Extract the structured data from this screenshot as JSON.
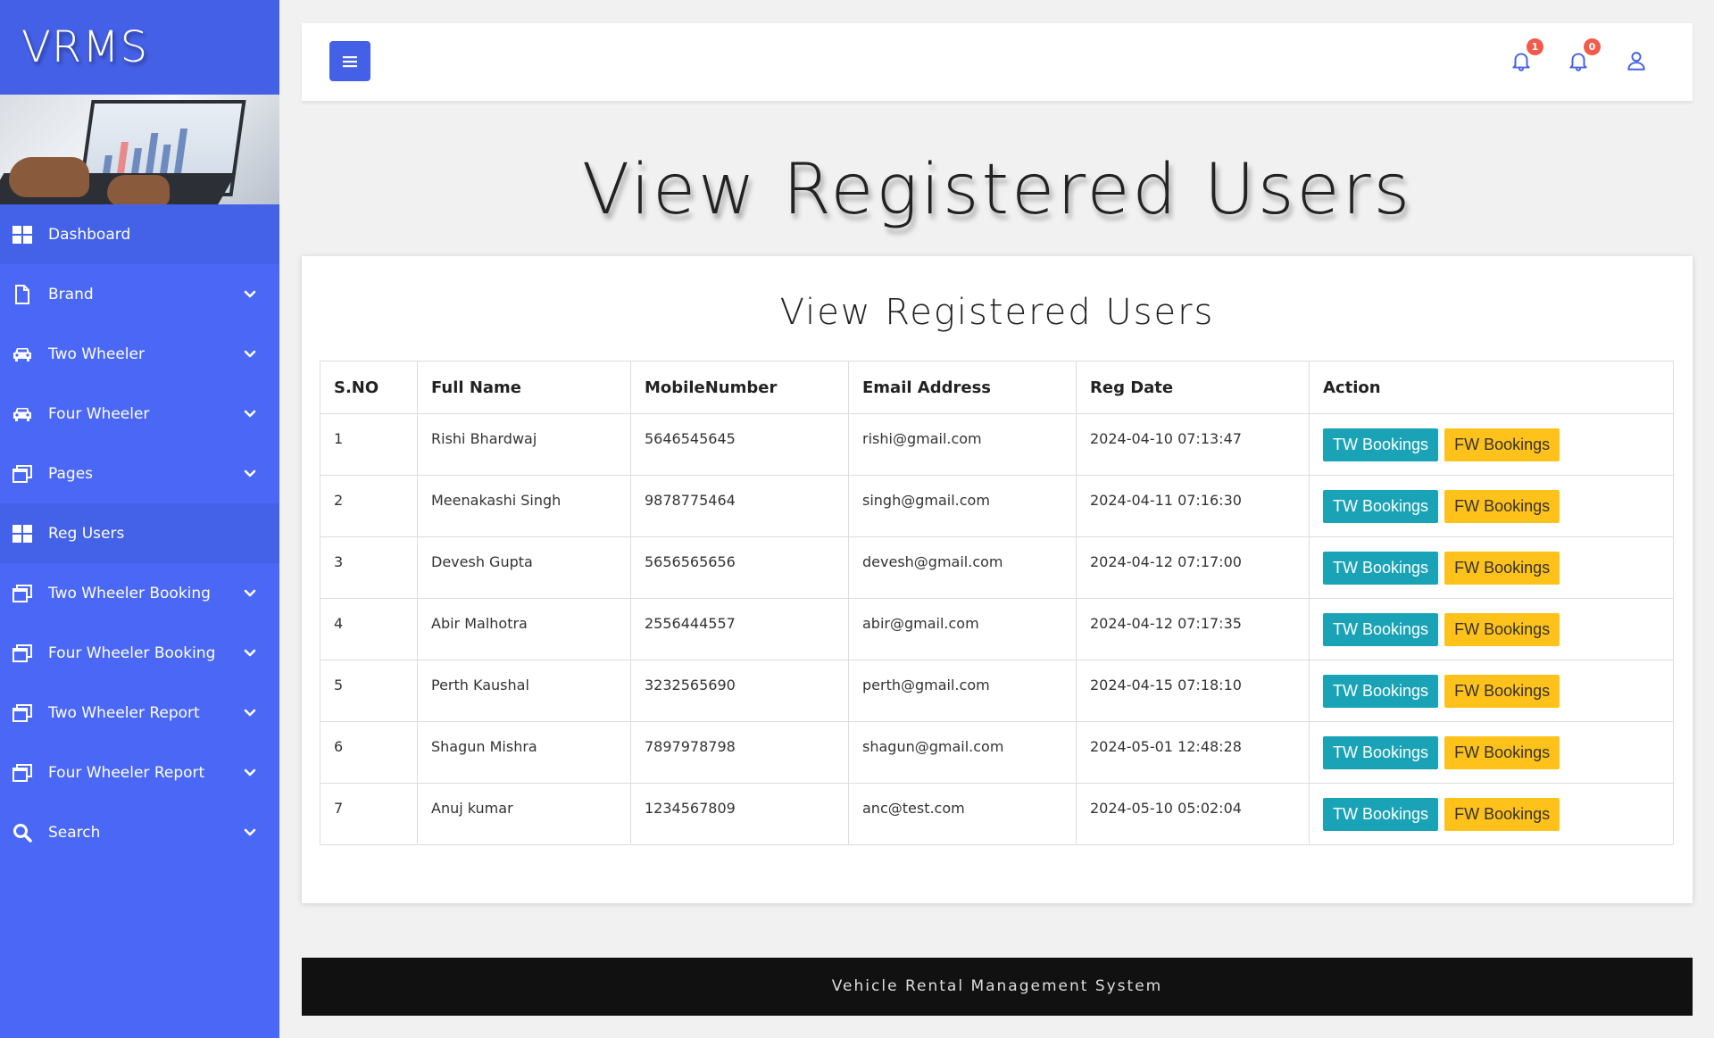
{
  "sidebar": {
    "brand": "VRMS",
    "items": [
      {
        "label": "Dashboard",
        "icon": "grid-icon",
        "has_submenu": false
      },
      {
        "label": "Brand",
        "icon": "file-icon",
        "has_submenu": true
      },
      {
        "label": "Two Wheeler",
        "icon": "car-icon",
        "has_submenu": true
      },
      {
        "label": "Four Wheeler",
        "icon": "car-icon",
        "has_submenu": true
      },
      {
        "label": "Pages",
        "icon": "windows-icon",
        "has_submenu": true
      },
      {
        "label": "Reg Users",
        "icon": "grid-icon",
        "has_submenu": false
      },
      {
        "label": "Two Wheeler Booking",
        "icon": "windows-icon",
        "has_submenu": true
      },
      {
        "label": "Four Wheeler Booking",
        "icon": "windows-icon",
        "has_submenu": true
      },
      {
        "label": "Two Wheeler Report",
        "icon": "windows-icon",
        "has_submenu": true
      },
      {
        "label": "Four Wheeler Report",
        "icon": "windows-icon",
        "has_submenu": true
      },
      {
        "label": "Search",
        "icon": "search-icon",
        "has_submenu": true
      }
    ]
  },
  "topbar": {
    "notifications_1_count": "1",
    "notifications_2_count": "0"
  },
  "page_heading": "View Registered Users",
  "card": {
    "title": "View Registered Users",
    "columns": [
      "S.NO",
      "Full Name",
      "MobileNumber",
      "Email Address",
      "Reg Date",
      "Action"
    ],
    "rows": [
      {
        "sno": "1",
        "name": "Rishi Bhardwaj",
        "mobile": "5646545645",
        "email": "rishi@gmail.com",
        "reg_date": "2024-04-10 07:13:47"
      },
      {
        "sno": "2",
        "name": "Meenakashi Singh",
        "mobile": "9878775464",
        "email": "singh@gmail.com",
        "reg_date": "2024-04-11 07:16:30"
      },
      {
        "sno": "3",
        "name": "Devesh Gupta",
        "mobile": "5656565656",
        "email": "devesh@gmail.com",
        "reg_date": "2024-04-12 07:17:00"
      },
      {
        "sno": "4",
        "name": "Abir Malhotra",
        "mobile": "2556444557",
        "email": "abir@gmail.com",
        "reg_date": "2024-04-12 07:17:35"
      },
      {
        "sno": "5",
        "name": "Perth Kaushal",
        "mobile": "3232565690",
        "email": "perth@gmail.com",
        "reg_date": "2024-04-15 07:18:10"
      },
      {
        "sno": "6",
        "name": "Shagun Mishra",
        "mobile": "7897978798",
        "email": "shagun@gmail.com",
        "reg_date": "2024-05-01 12:48:28"
      },
      {
        "sno": "7",
        "name": "Anuj kumar",
        "mobile": "1234567809",
        "email": "anc@test.com",
        "reg_date": "2024-05-10 05:02:04"
      }
    ],
    "tw_label": "TW Bookings",
    "fw_label": "FW Bookings"
  },
  "footer": "Vehicle Rental Management System",
  "colors": {
    "sidebar": "#4a68f5",
    "brand_bar": "#4460e6",
    "tw_button": "#1aa3b6",
    "fw_button": "#ffc21a",
    "badge": "#f25a4c",
    "footer": "#111111"
  }
}
